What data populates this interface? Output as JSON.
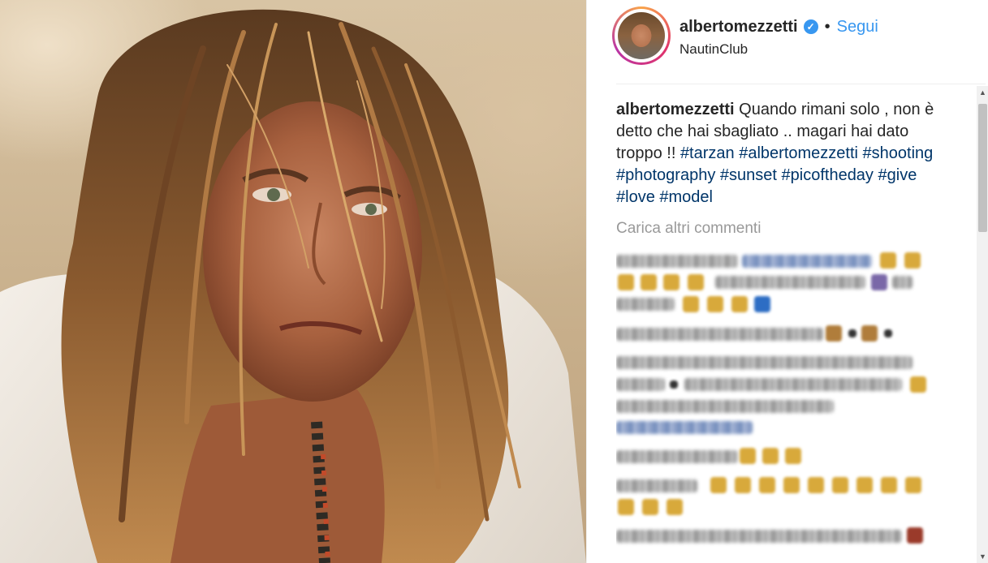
{
  "post": {
    "username": "albertomezzetti",
    "verified_glyph": "✓",
    "separator": "•",
    "follow_label": "Segui",
    "location": "NautinClub",
    "caption_username": "albertomezzetti",
    "caption_text": " Quando rimani solo , non è detto che hai sbagliato .. magari hai dato troppo !! ",
    "hashtags": [
      "#tarzan",
      "#albertomezzetti",
      "#shooting",
      "#photography",
      "#sunset",
      "#picoftheday",
      "#give",
      "#love",
      "#model"
    ],
    "load_more_label": "Carica altri commenti"
  },
  "icons": {
    "verified": "verified-badge-icon",
    "scroll_up": "scroll-up-arrow-icon",
    "scroll_down": "scroll-down-arrow-icon"
  },
  "colors": {
    "link_blue": "#3897f0",
    "hashtag": "#003569",
    "muted": "#999999"
  }
}
